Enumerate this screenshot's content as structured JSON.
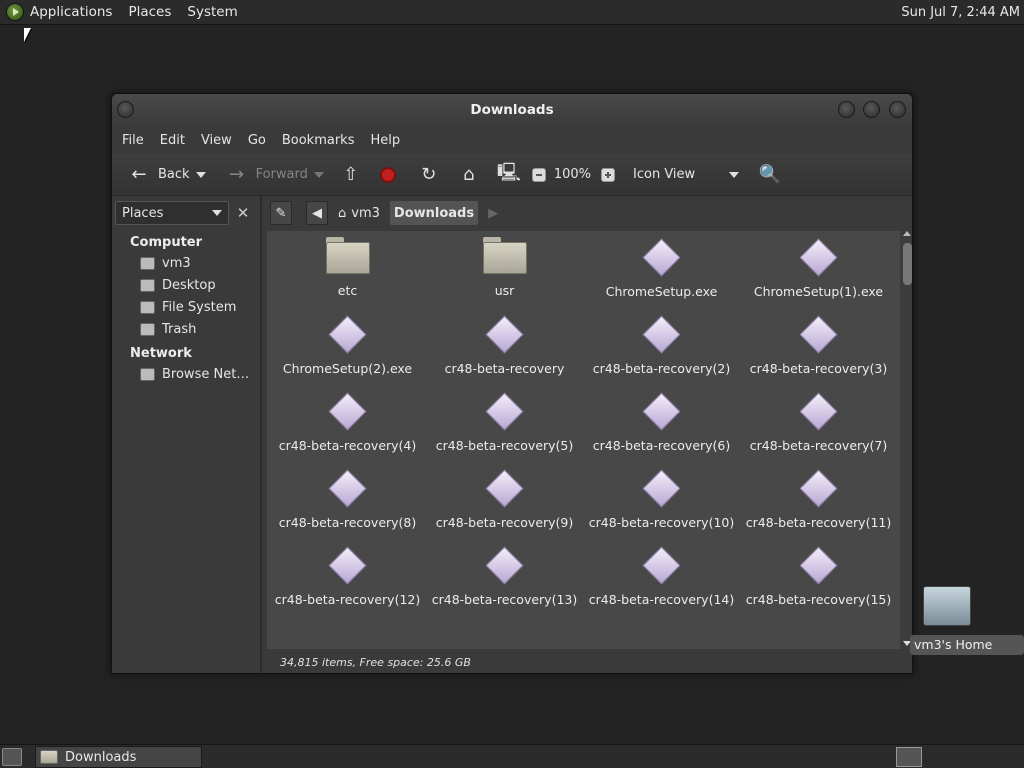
{
  "top_panel": {
    "menus": [
      "Applications",
      "Places",
      "System"
    ],
    "clock": "Sun Jul 7, 2:44 AM"
  },
  "window": {
    "title": "Downloads",
    "menubar": [
      "File",
      "Edit",
      "View",
      "Go",
      "Bookmarks",
      "Help"
    ],
    "toolbar": {
      "back": "Back",
      "forward": "Forward",
      "zoom": "100%",
      "view_mode": "Icon View"
    },
    "sidebar": {
      "selector": "Places",
      "sections": [
        {
          "heading": "Computer",
          "items": [
            "vm3",
            "Desktop",
            "File System",
            "Trash"
          ]
        },
        {
          "heading": "Network",
          "items": [
            "Browse Net…"
          ]
        }
      ]
    },
    "path": [
      "vm3",
      "Downloads"
    ],
    "files": [
      {
        "name": "etc",
        "type": "folder"
      },
      {
        "name": "usr",
        "type": "folder"
      },
      {
        "name": "ChromeSetup.exe",
        "type": "exe"
      },
      {
        "name": "ChromeSetup(1).exe",
        "type": "exe"
      },
      {
        "name": "ChromeSetup(2).exe",
        "type": "exe"
      },
      {
        "name": "cr48-beta-recovery",
        "type": "exe"
      },
      {
        "name": "cr48-beta-recovery(2)",
        "type": "exe"
      },
      {
        "name": "cr48-beta-recovery(3)",
        "type": "exe"
      },
      {
        "name": "cr48-beta-recovery(4)",
        "type": "exe"
      },
      {
        "name": "cr48-beta-recovery(5)",
        "type": "exe"
      },
      {
        "name": "cr48-beta-recovery(6)",
        "type": "exe"
      },
      {
        "name": "cr48-beta-recovery(7)",
        "type": "exe"
      },
      {
        "name": "cr48-beta-recovery(8)",
        "type": "exe"
      },
      {
        "name": "cr48-beta-recovery(9)",
        "type": "exe"
      },
      {
        "name": "cr48-beta-recovery(10)",
        "type": "exe"
      },
      {
        "name": "cr48-beta-recovery(11)",
        "type": "exe"
      },
      {
        "name": "cr48-beta-recovery(12)",
        "type": "exe"
      },
      {
        "name": "cr48-beta-recovery(13)",
        "type": "exe"
      },
      {
        "name": "cr48-beta-recovery(14)",
        "type": "exe"
      },
      {
        "name": "cr48-beta-recovery(15)",
        "type": "exe"
      }
    ],
    "status": "34,815 items, Free space: 25.6 GB"
  },
  "desktop": {
    "home_icon_label": "vm3's Home"
  },
  "bottom_panel": {
    "task": "Downloads"
  }
}
